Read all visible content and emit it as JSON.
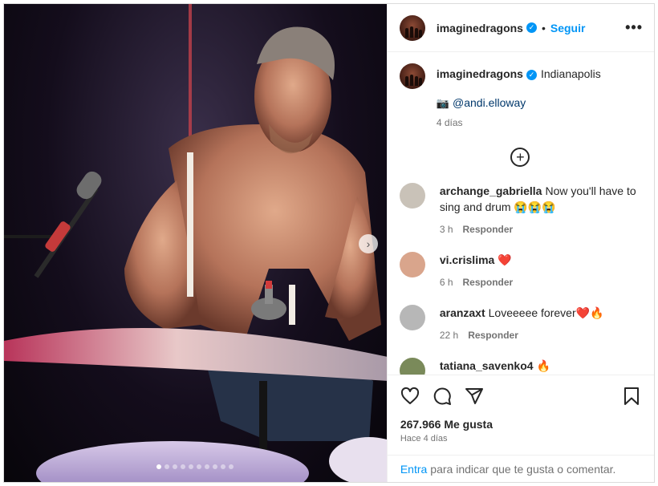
{
  "post": {
    "username": "imaginedragons",
    "follow_label": "Seguir",
    "more_label": "•••",
    "separator": "•",
    "location": "Indianapolis",
    "credit_icon": "camera-emoji",
    "credit_mention": "@andi.elloway",
    "caption_time": "4 días",
    "load_more_icon": "plus-circle-icon",
    "next_icon": "chevron-right-icon",
    "verified_icon": "✓",
    "slides_total": 10,
    "slide_active": 1
  },
  "comments": [
    {
      "user": "archange_gabriella",
      "text": "Now you'll have to sing and drum 😭😭😭",
      "time": "3 h",
      "reply": "Responder"
    },
    {
      "user": "vi.crislima",
      "text": "❤️",
      "time": "6 h",
      "reply": "Responder"
    },
    {
      "user": "aranzaxt",
      "text": "Loveeeee forever❤️🔥",
      "time": "22 h",
      "reply": "Responder"
    },
    {
      "user": "tatiana_savenko4",
      "text": "🔥",
      "time": "",
      "reply": ""
    }
  ],
  "footer": {
    "likes": "267.966 Me gusta",
    "ago": "Hace 4 días",
    "login_link": "Entra",
    "login_text": "para indicar que te gusta o comentar."
  },
  "colors": {
    "link": "#0095f6",
    "mention": "#00376b",
    "heart": "#ed4956",
    "muted": "#737373"
  }
}
